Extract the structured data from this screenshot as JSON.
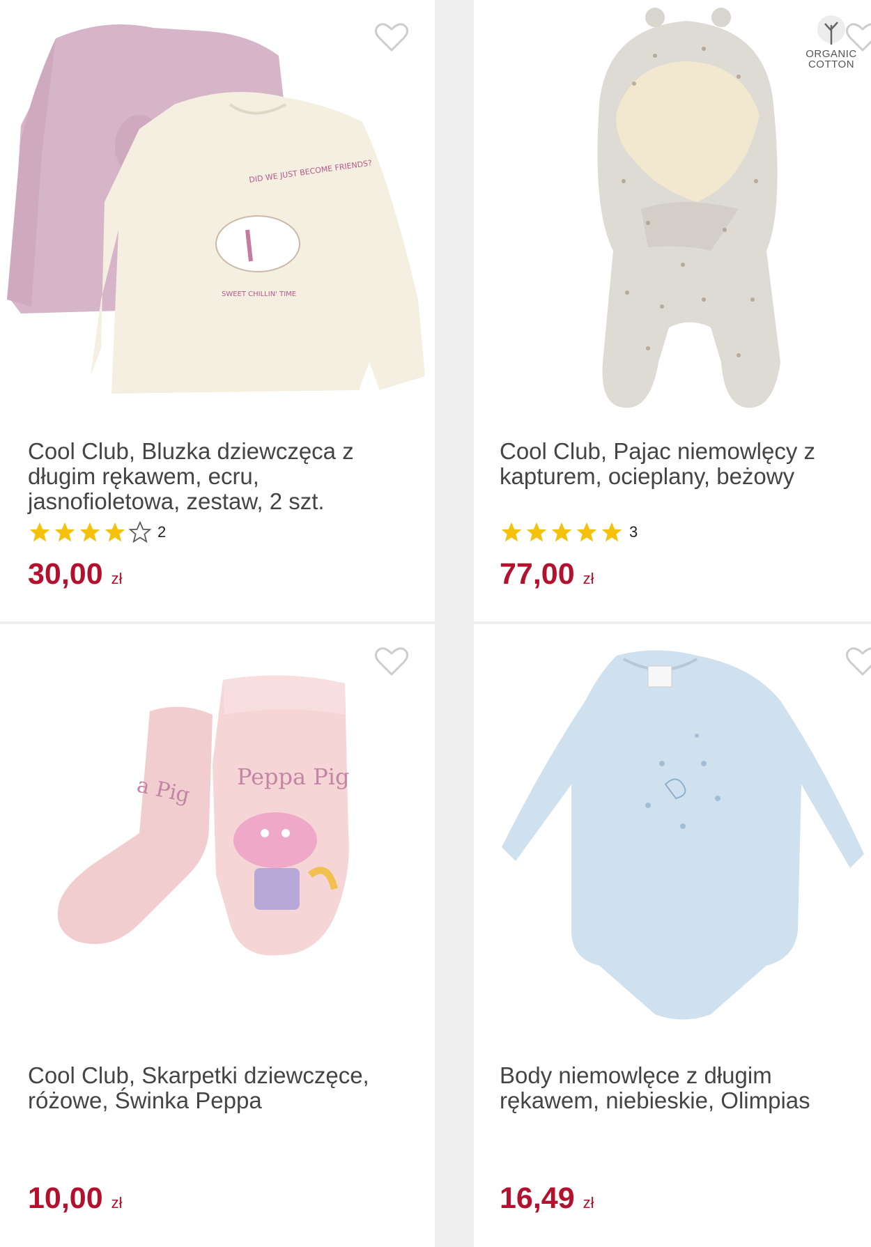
{
  "colors": {
    "price": "#b3122e",
    "star": "#f4c20d",
    "title_text": "#444444",
    "card_bg": "#ffffff",
    "page_bg": "#eeeeee"
  },
  "products": [
    {
      "title": "Cool Club, Bluzka dziewczęca z\ndługim rękawem, ecru,\njasnofioletowa, zestaw, 2 szt.",
      "rating_stars": 4,
      "rating_count": "2",
      "price_amount": "30,00",
      "price_currency": "zł",
      "image": "two-long-sleeve-shirts-pink-and-ecru",
      "image_print": {
        "top": "DID WE JUST BECOME FRIENDS?",
        "bottom": "SWEET CHILLIN' TIME"
      },
      "icon": "heart-outline-icon"
    },
    {
      "title": "Cool Club, Pajac niemowlęcy z\nkapturem, ocieplany, beżowy",
      "rating_stars": 5,
      "rating_count": "3",
      "price_amount": "77,00",
      "price_currency": "zł",
      "image": "beige-hooded-baby-sleepsuit",
      "badge": {
        "line1": "ORGANIC",
        "line2": "COTTON",
        "icon": "tree-icon"
      },
      "icon": "heart-outline-icon"
    },
    {
      "title": "Cool Club, Skarpetki dziewczęce,\nróżowe, Świnka Peppa",
      "price_amount": "10,00",
      "price_currency": "zł",
      "image": "pink-peppa-pig-socks",
      "image_print": {
        "brand": "Peppa Pig"
      },
      "icon": "heart-outline-icon"
    },
    {
      "title": "Body niemowlęce z długim\nrękawem, niebieskie, Olimpias",
      "price_amount": "16,49",
      "price_currency": "zł",
      "image": "light-blue-long-sleeve-bodysuit",
      "icon": "heart-outline-icon"
    }
  ]
}
